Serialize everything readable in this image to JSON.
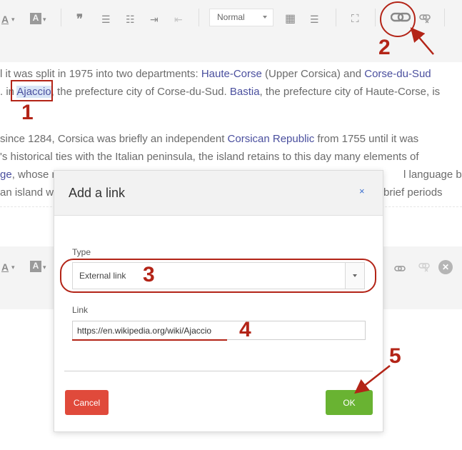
{
  "toolbar_top": {
    "text_color_icon": "A",
    "bg_color_icon": "A",
    "quote_icon": "❞",
    "bullets_icon": "☰",
    "numbered_icon": "☷",
    "indent_icon": "⇥",
    "outdent_icon": "⇤",
    "format_select": "Normal",
    "table_icon": "▦",
    "hr_icon": "☰",
    "fullscreen_icon": "⛶",
    "link_icon": "🔗",
    "unlink_icon": "⛓"
  },
  "toolbar_mid": {
    "text_color_icon": "A",
    "bg_color_icon": "A",
    "link_icon": "⛓",
    "unlink_icon": "⛓",
    "close_icon": "✕"
  },
  "paragraph1": {
    "line1_a": "l it was split in 1975 into two departments: ",
    "line1_link1": "Haute-Corse",
    "line1_b": " (Upper Corsica) and ",
    "line1_link2": "Corse-du-Sud",
    "line2_a": ". in ",
    "line2_link1": "Ajaccio",
    "line2_b": ", the prefecture city of Corse-du-Sud. ",
    "line2_link2": "Bastia",
    "line2_c": ", the prefecture city of Haute-Corse, is"
  },
  "paragraph2": {
    "line1_a": " since 1284, Corsica was briefly an independent ",
    "line1_link": "Corsican Republic",
    "line1_b": " from 1755 until it was",
    "line2": "'s historical ties with the Italian peninsula, the island retains to this day many elements of",
    "line3_link": "ge",
    "line3_a": ", whose n",
    "line3_b": "l language by",
    "line4_a": "an island wa",
    "line4_b": "brief periods"
  },
  "annotations": {
    "n1": "1",
    "n2": "2",
    "n3": "3",
    "n4": "4",
    "n5": "5",
    "color": "#b32417"
  },
  "modal": {
    "title": "Add a link",
    "close_label": "×",
    "type_label": "Type",
    "type_value": "External link",
    "link_label": "Link",
    "link_value": "https://en.wikipedia.org/wiki/Ajaccio",
    "cancel_label": "Cancel",
    "ok_label": "OK"
  },
  "colors": {
    "link": "#4a4f9e",
    "cancel": "#e04a3b",
    "ok": "#69b332"
  }
}
